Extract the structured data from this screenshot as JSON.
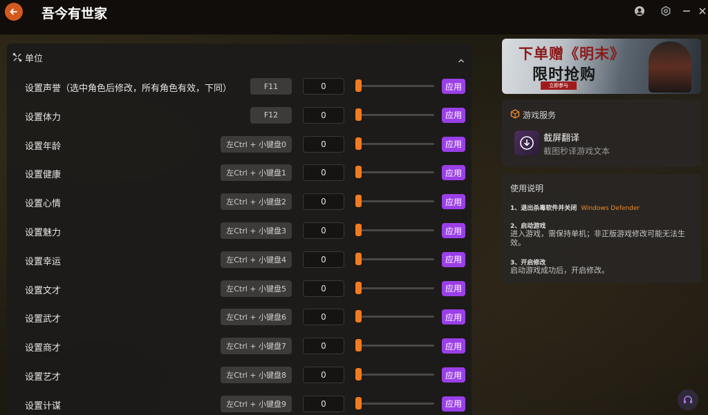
{
  "app": {
    "title": "吾今有世家"
  },
  "section": {
    "title": "单位"
  },
  "rows": [
    {
      "label": "设置声誉（选中角色后修改，所有角色有效，下同）",
      "hotkey": "F11",
      "value": "0",
      "apply": "应用"
    },
    {
      "label": "设置体力",
      "hotkey": "F12",
      "value": "0",
      "apply": "应用"
    },
    {
      "label": "设置年龄",
      "hotkey": "左Ctrl + 小键盘0",
      "value": "0",
      "apply": "应用"
    },
    {
      "label": "设置健康",
      "hotkey": "左Ctrl + 小键盘1",
      "value": "0",
      "apply": "应用"
    },
    {
      "label": "设置心情",
      "hotkey": "左Ctrl + 小键盘2",
      "value": "0",
      "apply": "应用"
    },
    {
      "label": "设置魅力",
      "hotkey": "左Ctrl + 小键盘3",
      "value": "0",
      "apply": "应用"
    },
    {
      "label": "设置幸运",
      "hotkey": "左Ctrl + 小键盘4",
      "value": "0",
      "apply": "应用"
    },
    {
      "label": "设置文才",
      "hotkey": "左Ctrl + 小键盘5",
      "value": "0",
      "apply": "应用"
    },
    {
      "label": "设置武才",
      "hotkey": "左Ctrl + 小键盘6",
      "value": "0",
      "apply": "应用"
    },
    {
      "label": "设置商才",
      "hotkey": "左Ctrl + 小键盘7",
      "value": "0",
      "apply": "应用"
    },
    {
      "label": "设置艺才",
      "hotkey": "左Ctrl + 小键盘8",
      "value": "0",
      "apply": "应用"
    },
    {
      "label": "设置计谋",
      "hotkey": "左Ctrl + 小键盘9",
      "value": "0",
      "apply": "应用"
    }
  ],
  "banner": {
    "line1": "下单赠《明末》",
    "line2": "限时抢购",
    "cta": "立即参与"
  },
  "services": {
    "title": "游戏服务",
    "item_name": "截屏翻译",
    "item_desc": "截图秒译游戏文本"
  },
  "instructions": {
    "title": "使用说明",
    "step1_title": "1、退出杀毒软件并关闭",
    "step1_highlight": "Windows Defender",
    "step2_title": "2、启动游戏",
    "step2_text": "进入游戏，需保持单机；非正版游戏修改可能无法生效。",
    "step3_title": "3、开启修改",
    "step3_text": "启动游戏成功后，开启修改。"
  },
  "colors": {
    "accent_orange": "#f47a20",
    "apply_purple": "#9b3fe8",
    "back_button": "#d25a1e"
  },
  "icons": {
    "back": "back-arrow-icon",
    "user": "user-icon",
    "settings": "settings-icon",
    "minimize": "minimize-icon",
    "close": "close-icon",
    "section": "unit-icon",
    "collapse": "chevron-up-icon",
    "service": "cube-icon",
    "download": "download-icon",
    "support": "headset-icon"
  }
}
